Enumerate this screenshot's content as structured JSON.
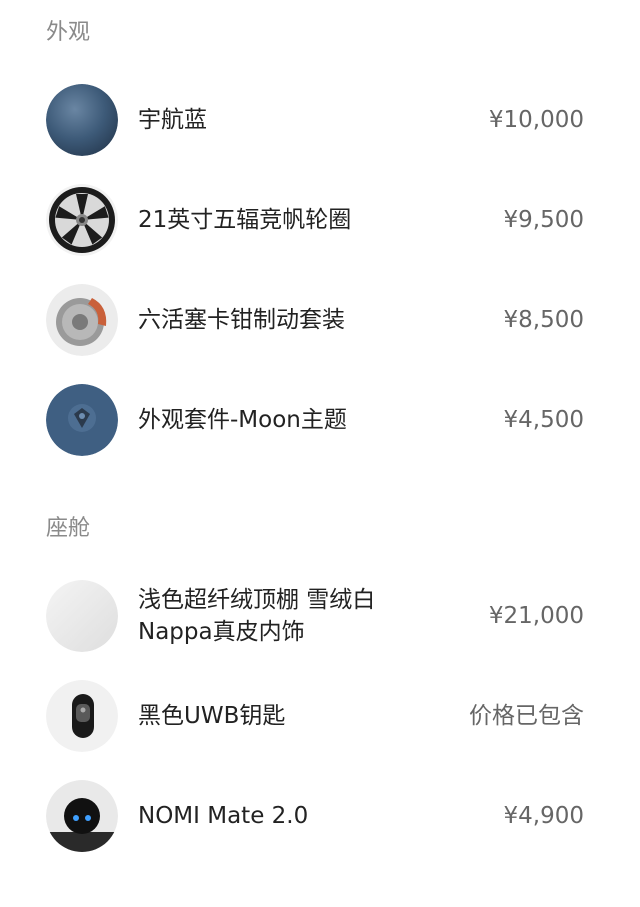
{
  "sections": [
    {
      "title": "外观",
      "items": [
        {
          "name": "宇航蓝",
          "price": "¥10,000",
          "icon": "blue-paint-swatch-icon"
        },
        {
          "name": "21英寸五辐竞帆轮圈",
          "price": "¥9,500",
          "icon": "wheel-rim-icon"
        },
        {
          "name": "六活塞卡钳制动套装",
          "price": "¥8,500",
          "icon": "brake-caliper-icon"
        },
        {
          "name": "外观套件-Moon主题",
          "price": "¥4,500",
          "icon": "moon-theme-icon"
        }
      ]
    },
    {
      "title": "座舱",
      "items": [
        {
          "name_line1": "浅色超纤绒顶棚 雪绒白",
          "name_line2": "Nappa真皮内饰",
          "price": "¥21,000",
          "icon": "interior-swatch-icon"
        },
        {
          "name": "黑色UWB钥匙",
          "price": "价格已包含",
          "icon": "uwb-key-icon"
        },
        {
          "name": "NOMI Mate 2.0",
          "price": "¥4,900",
          "icon": "nomi-mate-icon"
        }
      ]
    }
  ],
  "colors": {
    "blue_paint": "#3d5a78",
    "section_title": "#8a8a8a",
    "price_text": "#666666"
  }
}
